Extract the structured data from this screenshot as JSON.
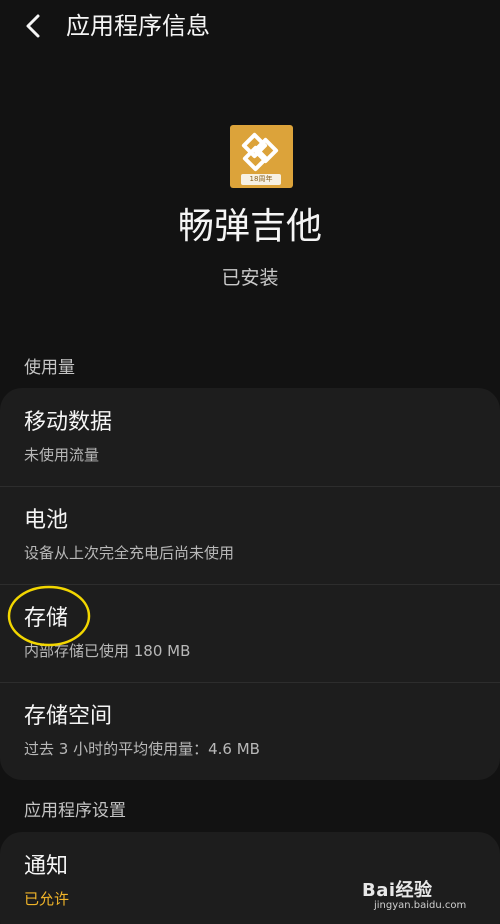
{
  "header": {
    "title": "应用程序信息",
    "back_icon": "chevron-left-icon"
  },
  "app": {
    "name": "畅弹吉他",
    "status": "已安装",
    "icon_badge": "18周年",
    "icon_color": "#dca33a"
  },
  "sections": {
    "usage_label": "使用量",
    "settings_label": "应用程序设置"
  },
  "usage_items": [
    {
      "title": "移动数据",
      "subtitle": "未使用流量"
    },
    {
      "title": "电池",
      "subtitle": "设备从上次完全充电后尚未使用"
    },
    {
      "title": "存储",
      "subtitle": "内部存储已使用 180 MB"
    },
    {
      "title": "存储空间",
      "subtitle": "过去 3 小时的平均使用量：4.6 MB"
    }
  ],
  "settings_items": [
    {
      "title": "通知",
      "subtitle": "已允许",
      "subtitle_color": "#f0b429"
    }
  ],
  "watermark": {
    "brand": "Bai经验",
    "url": "jingyan.baidu.com"
  },
  "colors": {
    "background": "#121212",
    "card": "#1d1d1d",
    "accent_yellow": "#f0b429",
    "highlight_circle": "#f2d600"
  }
}
